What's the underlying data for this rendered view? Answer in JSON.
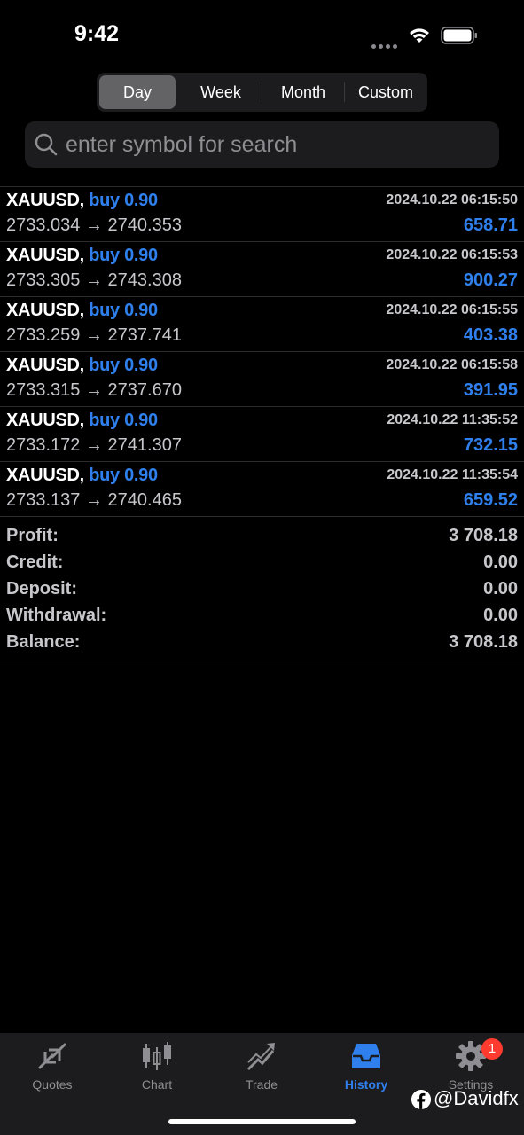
{
  "status": {
    "time": "9:42"
  },
  "periods": [
    {
      "label": "Day",
      "active": true
    },
    {
      "label": "Week",
      "active": false
    },
    {
      "label": "Month",
      "active": false
    },
    {
      "label": "Custom",
      "active": false
    }
  ],
  "search": {
    "placeholder": "enter symbol for search",
    "value": ""
  },
  "deals": [
    {
      "symbol": "XAUUSD,",
      "side": "buy 0.90",
      "open": "2733.034",
      "arrow": "→",
      "close": "2740.353",
      "datetime": "2024.10.22 06:15:50",
      "profit": "658.71"
    },
    {
      "symbol": "XAUUSD,",
      "side": "buy 0.90",
      "open": "2733.305",
      "arrow": "→",
      "close": "2743.308",
      "datetime": "2024.10.22 06:15:53",
      "profit": "900.27"
    },
    {
      "symbol": "XAUUSD,",
      "side": "buy 0.90",
      "open": "2733.259",
      "arrow": "→",
      "close": "2737.741",
      "datetime": "2024.10.22 06:15:55",
      "profit": "403.38"
    },
    {
      "symbol": "XAUUSD,",
      "side": "buy 0.90",
      "open": "2733.315",
      "arrow": "→",
      "close": "2737.670",
      "datetime": "2024.10.22 06:15:58",
      "profit": "391.95"
    },
    {
      "symbol": "XAUUSD,",
      "side": "buy 0.90",
      "open": "2733.172",
      "arrow": "→",
      "close": "2741.307",
      "datetime": "2024.10.22 11:35:52",
      "profit": "732.15"
    },
    {
      "symbol": "XAUUSD,",
      "side": "buy 0.90",
      "open": "2733.137",
      "arrow": "→",
      "close": "2740.465",
      "datetime": "2024.10.22 11:35:54",
      "profit": "659.52"
    }
  ],
  "summary": [
    {
      "label": "Profit:",
      "value": "3 708.18"
    },
    {
      "label": "Credit:",
      "value": "0.00"
    },
    {
      "label": "Deposit:",
      "value": "0.00"
    },
    {
      "label": "Withdrawal:",
      "value": "0.00"
    },
    {
      "label": "Balance:",
      "value": "3 708.18"
    }
  ],
  "tabs": [
    {
      "label": "Quotes",
      "icon": "quotes-icon",
      "active": false
    },
    {
      "label": "Chart",
      "icon": "chart-icon",
      "active": false
    },
    {
      "label": "Trade",
      "icon": "trade-icon",
      "active": false
    },
    {
      "label": "History",
      "icon": "history-icon",
      "active": true
    },
    {
      "label": "Settings",
      "icon": "gear-icon",
      "active": false
    }
  ],
  "settings_badge": "1",
  "watermark": {
    "handle": "@Davidfx"
  },
  "colors": {
    "accent": "#2f80ed",
    "badge": "#ff3b30",
    "background": "#000000"
  }
}
